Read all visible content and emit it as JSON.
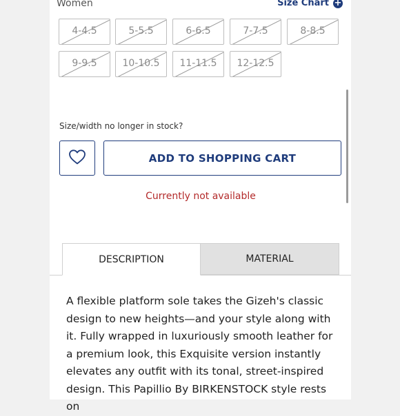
{
  "header": {
    "women_label": "Women",
    "size_chart_label": "Size Chart",
    "size_chart_icon": "plus-circle-icon"
  },
  "sizes": {
    "row1": [
      "4-4.5",
      "5-5.5",
      "6-6.5",
      "7-7.5",
      "8-8.5"
    ],
    "row2": [
      "9-9.5",
      "10-10.5",
      "11-11.5",
      "12-12.5"
    ]
  },
  "stock_message": "Size/width no longer in stock?",
  "wishlist_icon": "heart-icon",
  "add_to_cart_label": "ADD TO SHOPPING CART",
  "availability_text": "Currently not available",
  "tabs": [
    {
      "label": "DESCRIPTION"
    },
    {
      "label": "MATERIAL"
    }
  ],
  "description": "A flexible platform sole takes the Gizeh's classic design to new heights—and your style along with it. Fully wrapped in luxuriously smooth leather for a premium look, this Exquisite version instantly elevates any outfit with its tonal, street-inspired design. This Papillio By BIRKENSTOCK style rests on",
  "colors": {
    "brand": "#1f3c7c",
    "error": "#b32a2a",
    "inactive_tab": "#e1e1e1"
  }
}
